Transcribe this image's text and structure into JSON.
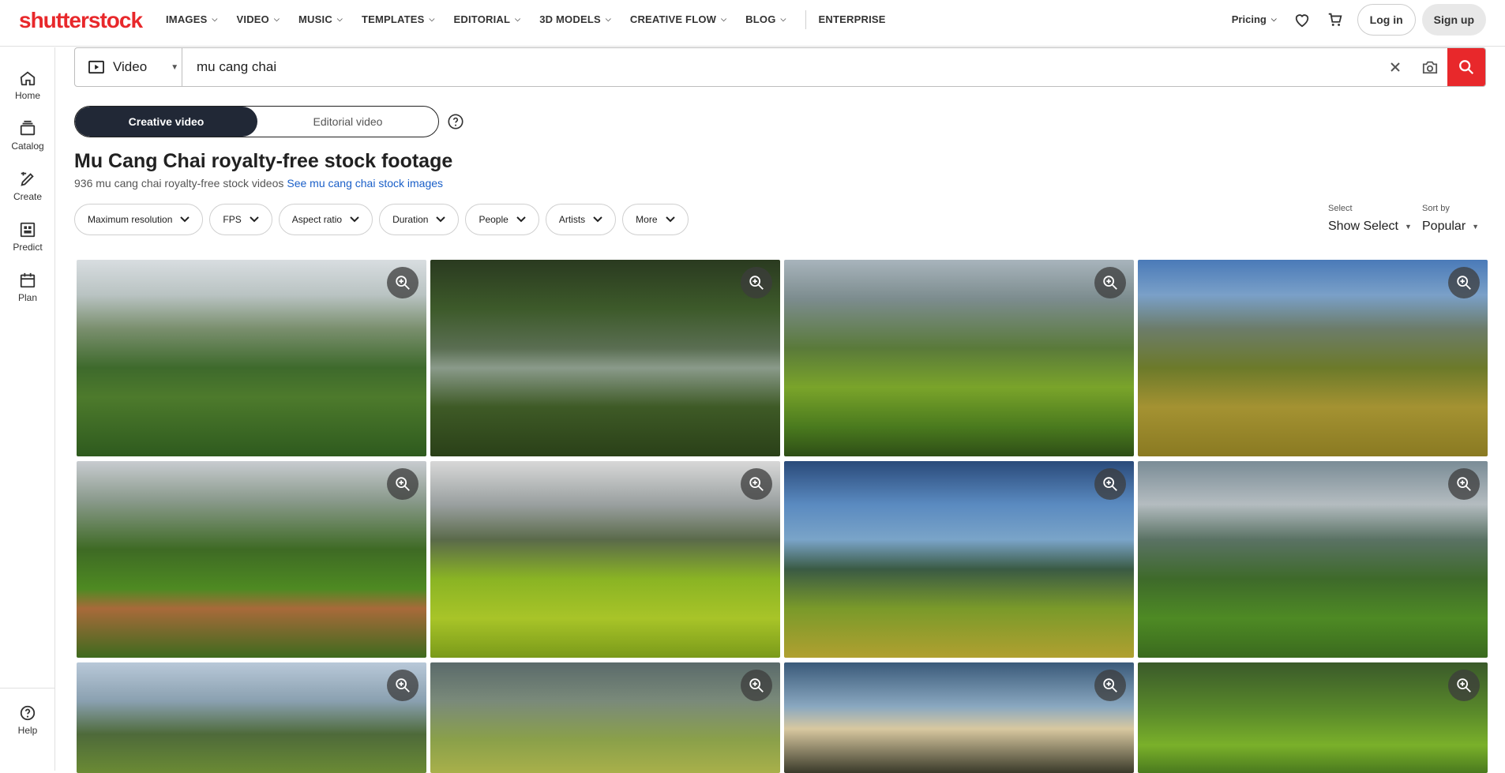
{
  "brand": {
    "logo_text": "shutterstock",
    "accent": "#e8282b"
  },
  "nav": {
    "items": [
      {
        "label": "IMAGES",
        "dropdown": true
      },
      {
        "label": "VIDEO",
        "dropdown": true
      },
      {
        "label": "MUSIC",
        "dropdown": true
      },
      {
        "label": "TEMPLATES",
        "dropdown": true
      },
      {
        "label": "EDITORIAL",
        "dropdown": true
      },
      {
        "label": "3D MODELS",
        "dropdown": true
      },
      {
        "label": "CREATIVE FLOW",
        "dropdown": true
      },
      {
        "label": "BLOG",
        "dropdown": true
      }
    ],
    "enterprise": "ENTERPRISE",
    "pricing": "Pricing",
    "login": "Log in",
    "signup": "Sign up"
  },
  "rail": {
    "items": [
      {
        "label": "Home",
        "icon": "home-icon"
      },
      {
        "label": "Catalog",
        "icon": "catalog-icon"
      },
      {
        "label": "Create",
        "icon": "create-icon"
      },
      {
        "label": "Predict",
        "icon": "predict-icon"
      },
      {
        "label": "Plan",
        "icon": "plan-icon"
      }
    ],
    "help": "Help"
  },
  "search": {
    "media_type": "Video",
    "query": "mu cang chai"
  },
  "toggle": {
    "creative": "Creative video",
    "editorial": "Editorial video"
  },
  "results": {
    "title": "Mu Cang Chai royalty-free stock footage",
    "count_text": "936 mu cang chai royalty-free stock videos",
    "images_link": "See mu cang chai stock images"
  },
  "filters": [
    "Maximum resolution",
    "FPS",
    "Aspect ratio",
    "Duration",
    "People",
    "Artists",
    "More"
  ],
  "select": {
    "label": "Select",
    "value": "Show Select"
  },
  "sort": {
    "label": "Sort by",
    "value": "Popular"
  }
}
